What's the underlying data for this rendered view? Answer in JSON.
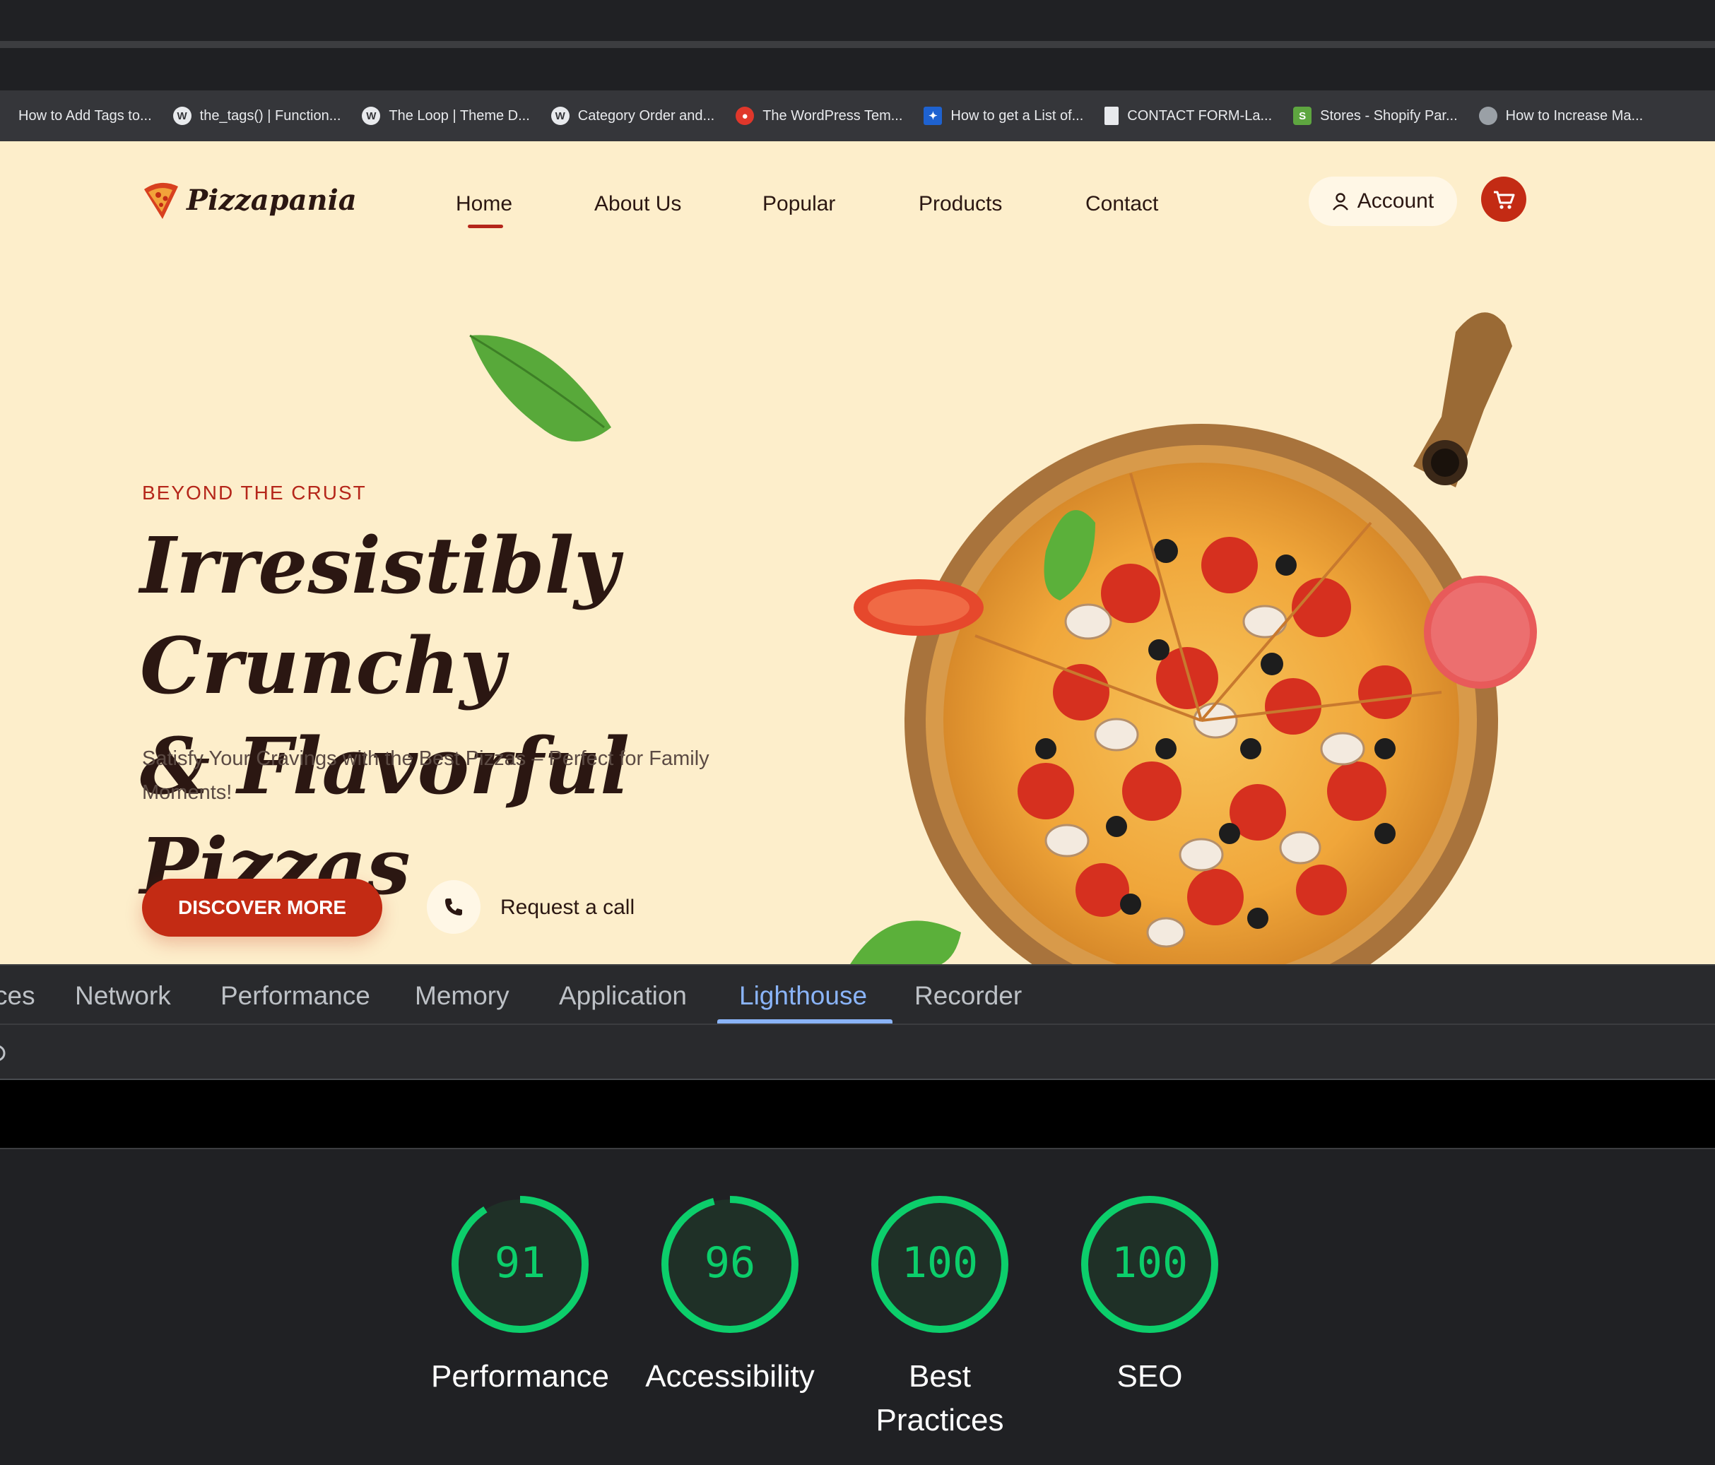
{
  "browser": {
    "bookmarks": [
      {
        "label": "How to Add Tags to...",
        "icon": "none"
      },
      {
        "label": "the_tags() | Function...",
        "icon": "wordpress-icon"
      },
      {
        "label": "The Loop | Theme D...",
        "icon": "wordpress-icon"
      },
      {
        "label": "Category Order and...",
        "icon": "wordpress-icon"
      },
      {
        "label": "The WordPress Tem...",
        "icon": "red-site-icon"
      },
      {
        "label": "How to get a List of...",
        "icon": "blue-site-icon"
      },
      {
        "label": "CONTACT FORM-La...",
        "icon": "document-icon"
      },
      {
        "label": "Stores - Shopify Par...",
        "icon": "shopify-icon"
      },
      {
        "label": "How to Increase Ma...",
        "icon": "globe-icon"
      }
    ]
  },
  "site": {
    "logo": "Pizzapania",
    "nav": [
      "Home",
      "About Us",
      "Popular",
      "Products",
      "Contact"
    ],
    "active_nav": "Home",
    "account_label": "Account",
    "tagline": "BEYOND THE CRUST",
    "headline_line1": "Irresistibly Crunchy",
    "headline_line2": "& Flavorful Pizzas",
    "subtitle": "Satisfy Your Cravings with the Best Pizzas – Perfect for Family Moments!",
    "cta_primary": "DISCOVER MORE",
    "cta_secondary": "Request a call",
    "colors": {
      "background": "#fdeecb",
      "accent": "#c32b14",
      "text": "#2b1712"
    }
  },
  "devtools": {
    "tabs": [
      "ces",
      "Network",
      "Performance",
      "Memory",
      "Application",
      "Lighthouse",
      "Recorder"
    ],
    "active_tab": "Lighthouse",
    "scores": [
      {
        "value": 91,
        "label": "Performance"
      },
      {
        "value": 96,
        "label": "Accessibility"
      },
      {
        "value": 100,
        "label": "Best Practices"
      },
      {
        "value": 100,
        "label": "SEO"
      }
    ],
    "score_color": "#0cce6b"
  }
}
